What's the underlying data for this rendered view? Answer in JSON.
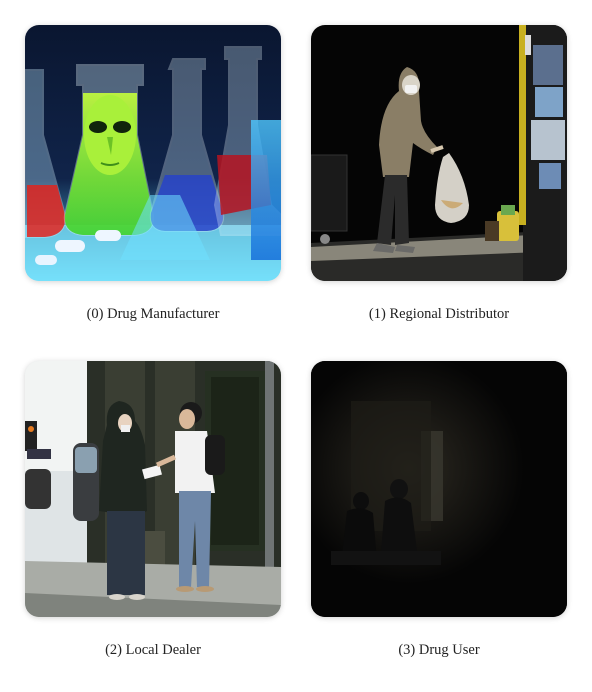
{
  "panels": [
    {
      "caption": "(0) Drug Manufacturer",
      "image": "chemistry-lab-flasks-with-mask"
    },
    {
      "caption": "(1) Regional Distributor",
      "image": "hooded-figure-with-plastic-bag"
    },
    {
      "caption": "(2) Local Dealer",
      "image": "two-people-talking-on-street"
    },
    {
      "caption": "(3) Drug User",
      "image": "silhouette-in-dark-room"
    }
  ]
}
